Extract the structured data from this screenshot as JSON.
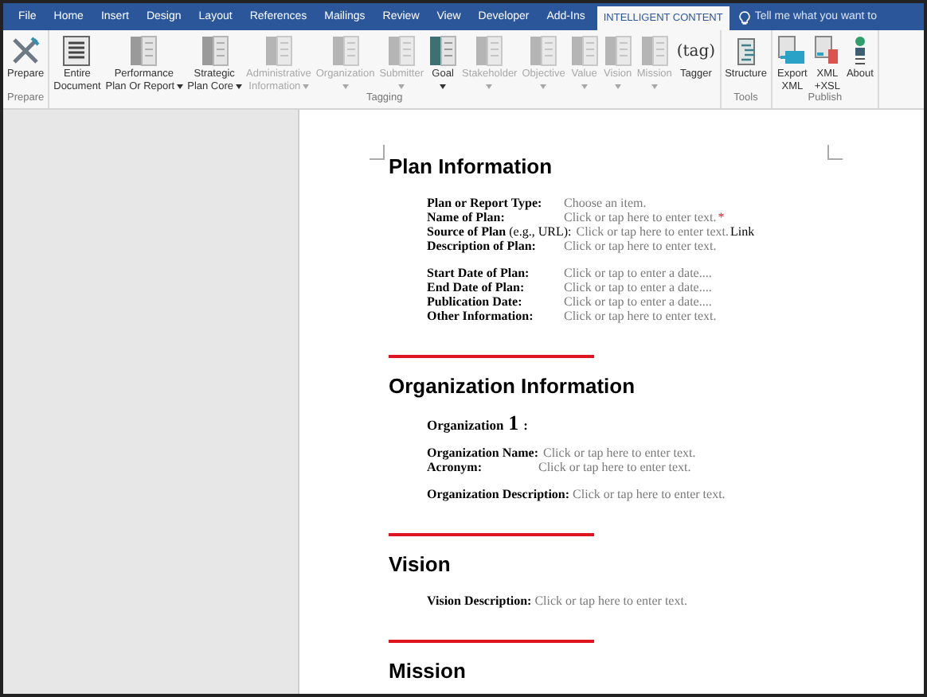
{
  "tabs": [
    {
      "label": "File",
      "selected": false
    },
    {
      "label": "Home",
      "selected": false
    },
    {
      "label": "Insert",
      "selected": false
    },
    {
      "label": "Design",
      "selected": false
    },
    {
      "label": "Layout",
      "selected": false
    },
    {
      "label": "References",
      "selected": false
    },
    {
      "label": "Mailings",
      "selected": false
    },
    {
      "label": "Review",
      "selected": false
    },
    {
      "label": "View",
      "selected": false
    },
    {
      "label": "Developer",
      "selected": false
    },
    {
      "label": "Add-Ins",
      "selected": false
    },
    {
      "label": "INTELLIGENT CONTENT",
      "selected": true
    }
  ],
  "tell_me": {
    "placeholder": "Tell me what you want to"
  },
  "ribbon_groups": [
    {
      "label": "Prepare",
      "buttons": [
        {
          "kind": "tools",
          "lines": [
            "Prepare"
          ],
          "disabled": false,
          "menu": false
        }
      ]
    },
    {
      "label": "Tagging",
      "buttons": [
        {
          "kind": "doc",
          "lines": [
            "Entire",
            "Document"
          ],
          "disabled": false,
          "menu": false
        },
        {
          "kind": "tag",
          "lines": [
            "Performance",
            "Plan Or Report"
          ],
          "disabled": false,
          "menu": true
        },
        {
          "kind": "tag",
          "lines": [
            "Strategic",
            "Plan Core"
          ],
          "disabled": false,
          "menu": true
        },
        {
          "kind": "tag",
          "lines": [
            "Administrative",
            "Information"
          ],
          "disabled": true,
          "menu": true
        },
        {
          "kind": "tag",
          "lines": [
            "Organization"
          ],
          "disabled": true,
          "menu": true
        },
        {
          "kind": "tag",
          "lines": [
            "Submitter"
          ],
          "disabled": true,
          "menu": true
        },
        {
          "kind": "goal",
          "lines": [
            "Goal"
          ],
          "disabled": false,
          "menu": true
        },
        {
          "kind": "tag",
          "lines": [
            "Stakeholder"
          ],
          "disabled": true,
          "menu": true
        },
        {
          "kind": "tag",
          "lines": [
            "Objective"
          ],
          "disabled": true,
          "menu": true
        },
        {
          "kind": "tag",
          "lines": [
            "Value"
          ],
          "disabled": true,
          "menu": true
        },
        {
          "kind": "tag",
          "lines": [
            "Vision"
          ],
          "disabled": true,
          "menu": true
        },
        {
          "kind": "tag",
          "lines": [
            "Mission"
          ],
          "disabled": true,
          "menu": true
        },
        {
          "kind": "tagger",
          "glyph": "(tag)",
          "lines": [
            "Tagger"
          ],
          "disabled": false,
          "menu": false
        }
      ]
    },
    {
      "label": "Tools",
      "buttons": [
        {
          "kind": "structure",
          "lines": [
            "Structure"
          ],
          "disabled": false,
          "menu": false
        }
      ]
    },
    {
      "label": "Publish",
      "buttons": [
        {
          "kind": "export",
          "lines": [
            "Export",
            "XML"
          ],
          "disabled": false,
          "menu": false
        },
        {
          "kind": "xsl",
          "lines": [
            "XML",
            "+XSL"
          ],
          "disabled": false,
          "menu": false
        },
        {
          "kind": "about",
          "lines": [
            "About"
          ],
          "disabled": false,
          "menu": false
        }
      ]
    }
  ],
  "document": {
    "sections": [
      {
        "heading": "Plan Information",
        "groups": [
          {
            "kind": "table",
            "fields": [
              {
                "label": "Plan or Report Type:",
                "value": "Choose an item."
              },
              {
                "label": "Name of Plan:",
                "value": "Click or tap here to enter text.",
                "required_mark": "*"
              },
              {
                "label": "**Source of Plan** (e.g., URL):",
                "value": "Click or tap here to enter text.",
                "link": "Link"
              },
              {
                "label": "Description of Plan:",
                "value": "Click or tap here to enter text."
              }
            ]
          },
          {
            "kind": "table",
            "fields": [
              {
                "label": "Start Date of Plan:",
                "value": "Click or tap to enter a date...."
              },
              {
                "label": "End Date of Plan:",
                "value": "Click or tap to enter a date...."
              },
              {
                "label": "Publication Date:",
                "value": "Click or tap to enter a date...."
              },
              {
                "label": "Other Information:",
                "value": "Click or tap here to enter text."
              }
            ]
          }
        ]
      },
      {
        "heading": "Organization Information",
        "groups": [
          {
            "kind": "title",
            "label": "Organization",
            "number": "1",
            "punct": ":"
          },
          {
            "kind": "table",
            "fields": [
              {
                "label": "Organization Name:",
                "value": "Click or tap here to enter text."
              },
              {
                "label": "Acronym:",
                "value": "Click or tap here to enter text."
              }
            ]
          },
          {
            "kind": "inline",
            "fields": [
              {
                "label": "Organization Description:",
                "value": "Click or tap here to enter text."
              }
            ]
          }
        ]
      },
      {
        "heading": "Vision",
        "groups": [
          {
            "kind": "inline",
            "fields": [
              {
                "label": "Vision Description:",
                "value": "Click or tap here to enter text."
              }
            ]
          }
        ]
      },
      {
        "heading": "Mission"
      }
    ]
  }
}
